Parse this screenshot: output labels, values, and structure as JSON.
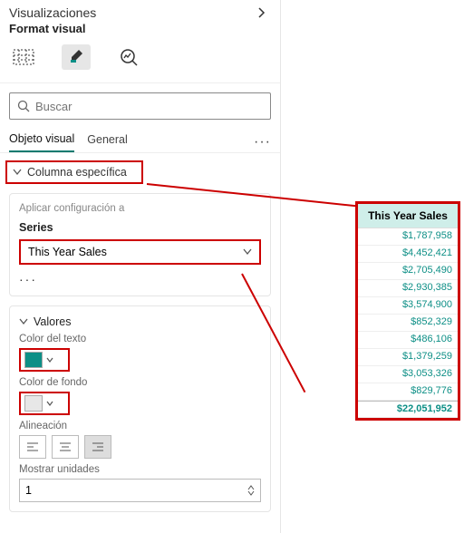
{
  "header": {
    "title": "Visualizaciones",
    "section": "Format visual"
  },
  "search": {
    "placeholder": "Buscar"
  },
  "tabs": {
    "visual": "Objeto visual",
    "general": "General"
  },
  "columna": {
    "label": "Columna específica"
  },
  "applyCard": {
    "hint": "Aplicar configuración a",
    "seriesLabel": "Series",
    "seriesValue": "This Year Sales"
  },
  "valores": {
    "header": "Valores",
    "textColorLabel": "Color del texto",
    "bgColorLabel": "Color de fondo",
    "alignLabel": "Alineación",
    "unitsLabel": "Mostrar unidades",
    "unitsValue": "1"
  },
  "colors": {
    "text": "#0d8f86",
    "bg": "#e7e7e7"
  },
  "table": {
    "header": "This Year Sales",
    "rows": [
      "$1,787,958",
      "$4,452,421",
      "$2,705,490",
      "$2,930,385",
      "$3,574,900",
      "$852,329",
      "$486,106",
      "$1,379,259",
      "$3,053,326",
      "$829,776"
    ],
    "total": "$22,051,952"
  }
}
